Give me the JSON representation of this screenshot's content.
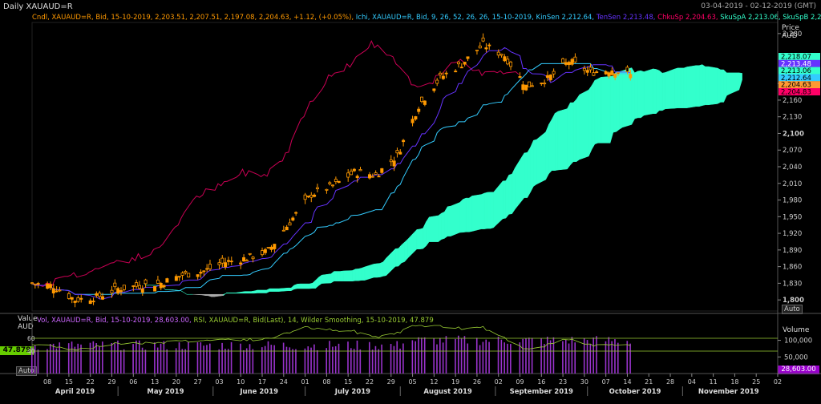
{
  "header": {
    "title": "Daily XAUAUD=R",
    "range": "03-04-2019 - 02-12-2019 (GMT)"
  },
  "legend_main": {
    "cndl": "Cndl, XAUAUD=R, Bid, 15-10-2019, 2,203.51, 2,207.51, 2,197.08, 2,204.63, +1.12, (+0.05%),",
    "ichi": "Ichi, XAUAUD=R, Bid, 9, 26, 52, 26, 26, 15-10-2019,",
    "kinsen": "KinSen 2,212.64,",
    "tensen": "TenSen 2,213.48,",
    "chikusp": "ChkuSp 2,204.63,",
    "skuspa": "SkuSpA 2,213.06,",
    "skuspb": "SkuSpB 2,218.07"
  },
  "legend_lower": {
    "vol": "Vol, XAUAUD=R, Bid, 15-10-2019, 28,603.00,",
    "rsi": "RSI, XAUAUD=R, Bid(Last), 14, Wilder Smoothing, 15-10-2019, 47.879"
  },
  "price_axis": {
    "label_line1": "Price",
    "label_line2": "AUD",
    "ticks": [
      {
        "label": "2,280",
        "v": 2280,
        "bold": false
      },
      {
        "label": "2,190",
        "v": 2190,
        "bold": false
      },
      {
        "label": "2,160",
        "v": 2160,
        "bold": false
      },
      {
        "label": "2,130",
        "v": 2130,
        "bold": false
      },
      {
        "label": "2,100",
        "v": 2100,
        "bold": true
      },
      {
        "label": "2,070",
        "v": 2070,
        "bold": false
      },
      {
        "label": "2,040",
        "v": 2040,
        "bold": false
      },
      {
        "label": "2,010",
        "v": 2010,
        "bold": false
      },
      {
        "label": "1,980",
        "v": 1980,
        "bold": false
      },
      {
        "label": "1,950",
        "v": 1950,
        "bold": false
      },
      {
        "label": "1,920",
        "v": 1920,
        "bold": false
      },
      {
        "label": "1,890",
        "v": 1890,
        "bold": false
      },
      {
        "label": "1,860",
        "v": 1860,
        "bold": false
      },
      {
        "label": "1,830",
        "v": 1830,
        "bold": false
      },
      {
        "label": "1,800",
        "v": 1800,
        "bold": true
      }
    ],
    "tags": [
      {
        "label": "2,218.07",
        "v": 2218.07,
        "bg": "#33ffcc",
        "fg": "#000000"
      },
      {
        "label": "2,213.48",
        "v": 2213.48,
        "bg": "#6633ff",
        "fg": "#ffffff"
      },
      {
        "label": "2,213.06",
        "v": 2213.06,
        "bg": "#33ffcc",
        "fg": "#000000"
      },
      {
        "label": "2,212.64",
        "v": 2212.64,
        "bg": "#33ccff",
        "fg": "#000000"
      },
      {
        "label": "2,204.63",
        "v": 2204.63,
        "bg": "#ff9933",
        "fg": "#000000"
      },
      {
        "label": "2,204.83",
        "v": 2204.83,
        "bg": "#ff0066",
        "fg": "#000000"
      }
    ],
    "auto_label": "Auto"
  },
  "lower_axis": {
    "left_label_1": "Value",
    "left_label_2": "AUD",
    "rsi_value": "47.879",
    "rsi_ticks": [
      "60",
      "40"
    ],
    "auto_label": "Auto",
    "right_label": "Volume",
    "vol_ticks": [
      {
        "label": "100,000",
        "v": 100000
      },
      {
        "label": "50,000",
        "v": 50000
      }
    ],
    "vol_tag": "28,603.00"
  },
  "time_axis": {
    "day_labels": [
      "08",
      "15",
      "22",
      "29",
      "06",
      "13",
      "20",
      "27",
      "03",
      "10",
      "17",
      "24",
      "01",
      "08",
      "15",
      "22",
      "29",
      "05",
      "12",
      "19",
      "26",
      "02",
      "09",
      "16",
      "23",
      "30",
      "07",
      "14",
      "21",
      "28",
      "04",
      "11",
      "18",
      "25",
      "02"
    ],
    "month_labels": [
      "April 2019",
      "May 2019",
      "June 2019",
      "July 2019",
      "August 2019",
      "September 2019",
      "October 2019",
      "November 2019"
    ]
  },
  "colors": {
    "background": "#000000",
    "candle": "#ff9900",
    "cloud_bull": "#33ffcc",
    "cloud_bear": "#aaaaaa",
    "tenkan": "#6633ff",
    "kijun": "#33ccff",
    "chikou": "#cc0055",
    "rsi": "#99cc33",
    "volume": "#9933cc",
    "grid": "#333333",
    "text": "#cccccc"
  },
  "chart_data": {
    "type": "candlestick",
    "title": "Daily XAUAUD=R",
    "ylim": [
      1780,
      2300
    ],
    "x_range": [
      "2019-04-03",
      "2019-12-02"
    ],
    "anchors": [
      [
        "2019-04-03",
        1830
      ],
      [
        "2019-04-10",
        1825
      ],
      [
        "2019-04-17",
        1800
      ],
      [
        "2019-04-24",
        1805
      ],
      [
        "2019-05-01",
        1820
      ],
      [
        "2019-05-08",
        1826
      ],
      [
        "2019-05-15",
        1830
      ],
      [
        "2019-05-22",
        1845
      ],
      [
        "2019-05-29",
        1852
      ],
      [
        "2019-06-05",
        1868
      ],
      [
        "2019-06-12",
        1875
      ],
      [
        "2019-06-19",
        1888
      ],
      [
        "2019-06-26",
        1940
      ],
      [
        "2019-07-03",
        1990
      ],
      [
        "2019-07-10",
        2005
      ],
      [
        "2019-07-17",
        2030
      ],
      [
        "2019-07-24",
        2025
      ],
      [
        "2019-07-31",
        2060
      ],
      [
        "2019-08-07",
        2150
      ],
      [
        "2019-08-14",
        2200
      ],
      [
        "2019-08-21",
        2225
      ],
      [
        "2019-08-28",
        2260
      ],
      [
        "2019-09-04",
        2240
      ],
      [
        "2019-09-11",
        2185
      ],
      [
        "2019-09-18",
        2198
      ],
      [
        "2019-09-25",
        2230
      ],
      [
        "2019-10-02",
        2210
      ],
      [
        "2019-10-09",
        2215
      ],
      [
        "2019-10-15",
        2204.63
      ]
    ],
    "last_candle": {
      "date": "2019-10-15",
      "open": 2203.51,
      "high": 2207.51,
      "low": 2197.08,
      "close": 2204.63,
      "change": 1.12,
      "change_pct": 0.05
    },
    "ichimoku": {
      "params": [
        9,
        26,
        52,
        26,
        26
      ],
      "kijun_sen": 2212.64,
      "tenkan_sen": 2213.48,
      "chikou_span": 2204.63,
      "senkou_span_a": 2213.06,
      "senkou_span_b": 2218.07
    },
    "volume_last": 28603.0,
    "rsi": {
      "period": 14,
      "smoothing": "Wilder",
      "last": 47.879
    }
  }
}
